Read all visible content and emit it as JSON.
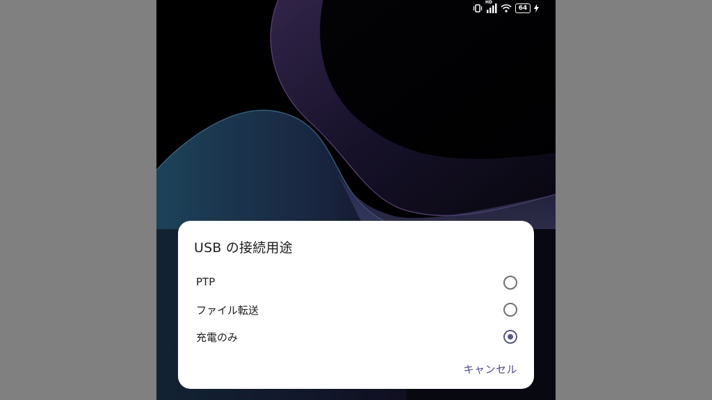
{
  "status_bar": {
    "battery_level": "64",
    "network_type": "HD",
    "icons": [
      "vibrate-icon",
      "signal-icon",
      "wifi-icon",
      "battery-icon",
      "charging-icon"
    ]
  },
  "dialog": {
    "title": "USB の接続用途",
    "options": [
      {
        "label": "PTP",
        "selected": false
      },
      {
        "label": "ファイル転送",
        "selected": false
      },
      {
        "label": "充電のみ",
        "selected": true
      }
    ],
    "cancel_label": "キャンセル"
  },
  "colors": {
    "accent": "#5a5786",
    "dialog_bg": "#ffffff",
    "letterbox": "#808080",
    "wallpaper_bg": "#000000"
  }
}
